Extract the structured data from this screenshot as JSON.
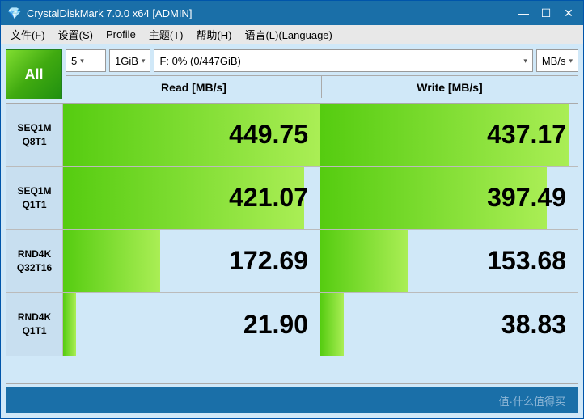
{
  "titlebar": {
    "title": "CrystalDiskMark 7.0.0 x64 [ADMIN]",
    "icon": "💎",
    "minimize": "—",
    "maximize": "☐",
    "close": "✕"
  },
  "menubar": {
    "items": [
      {
        "id": "file",
        "label": "文件(F)"
      },
      {
        "id": "settings",
        "label": "设置(S)"
      },
      {
        "id": "profile",
        "label": "Profile"
      },
      {
        "id": "theme",
        "label": "主题(T)"
      },
      {
        "id": "help",
        "label": "帮助(H)"
      },
      {
        "id": "language",
        "label": "语言(L)(Language)"
      }
    ]
  },
  "toolbar": {
    "all_button": "All",
    "count": "5",
    "size": "1GiB",
    "drive": "F: 0% (0/447GiB)",
    "unit": "MB/s"
  },
  "table": {
    "headers": {
      "read": "Read [MB/s]",
      "write": "Write [MB/s]"
    },
    "rows": [
      {
        "label": "SEQ1M\nQ8T1",
        "read": "449.75",
        "write": "437.17",
        "read_pct": 100,
        "write_pct": 97
      },
      {
        "label": "SEQ1M\nQ1T1",
        "read": "421.07",
        "write": "397.49",
        "read_pct": 94,
        "write_pct": 88
      },
      {
        "label": "RND4K\nQ32T16",
        "read": "172.69",
        "write": "153.68",
        "read_pct": 38,
        "write_pct": 34
      },
      {
        "label": "RND4K\nQ1T1",
        "read": "21.90",
        "write": "38.83",
        "read_pct": 5,
        "write_pct": 9
      }
    ]
  },
  "watermark": "值·什么值得买"
}
